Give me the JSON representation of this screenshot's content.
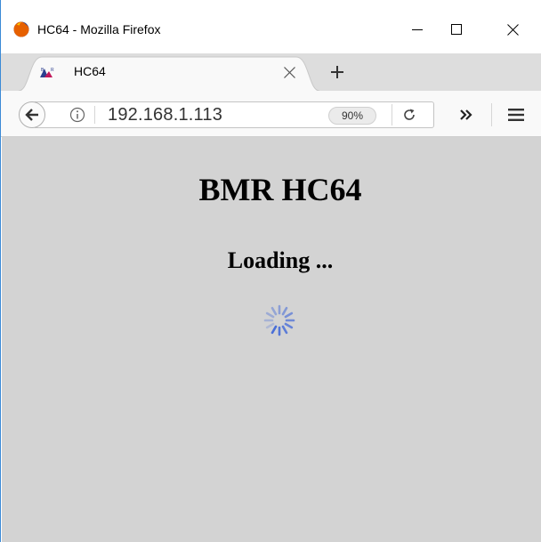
{
  "window": {
    "title": "HC64 - Mozilla Firefox"
  },
  "tabs": [
    {
      "title": "HC64",
      "favicon": "bmr-logo-icon",
      "active": true
    }
  ],
  "navbar": {
    "url": "192.168.1.113",
    "zoom": "90%"
  },
  "page": {
    "heading": "BMR HC64",
    "status": "Loading ..."
  },
  "colors": {
    "content_bg": "#d3d3d3",
    "spinner": "#4a6fd8",
    "window_border": "#3b8ad6"
  }
}
